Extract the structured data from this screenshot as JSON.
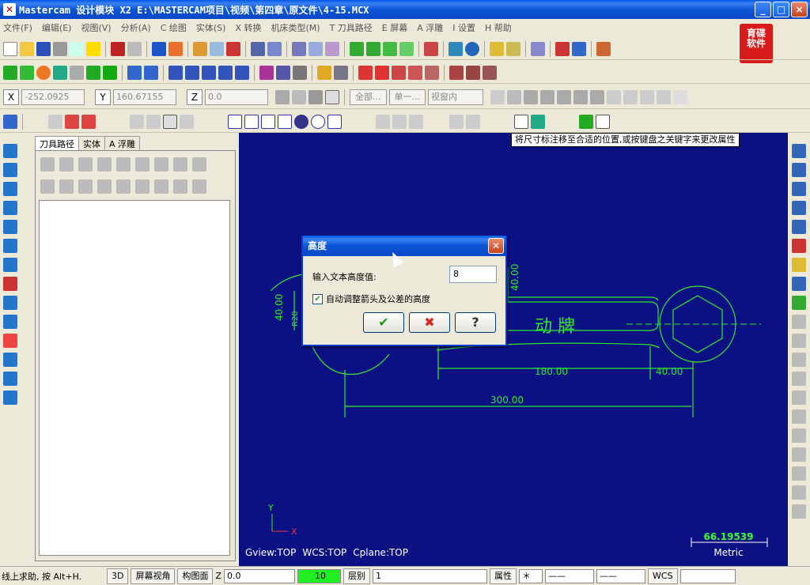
{
  "window": {
    "title": "Mastercam 设计模块  X2  E:\\MASTERCAM项目\\视频\\第四章\\原文件\\4-15.MCX",
    "controls": {
      "minimize": "_",
      "maximize": "□",
      "close": "×"
    }
  },
  "menu": [
    "文件(F)",
    "编辑(E)",
    "视图(V)",
    "分析(A)",
    "C 绘图",
    "实体(S)",
    "X 转换",
    "机床类型(M)",
    "T 刀具路径",
    "E 屏幕",
    "A 浮雕",
    "I 设置",
    "H 帮助"
  ],
  "logo": {
    "line1": "育碟",
    "line2": "软件"
  },
  "coords": {
    "x_label": "X",
    "x_value": "-252.0925",
    "y_label": "Y",
    "y_value": "160.67155",
    "z_label": "Z",
    "z_value": "0.0",
    "all_button": "全部...",
    "single_button": "单一...",
    "view_select": "视窗内"
  },
  "left_panel": {
    "tabs": [
      "刀具路径",
      "实体",
      "A 浮雕"
    ]
  },
  "canvas": {
    "hint": "将尺寸标注移至合适的位置,或按键盘之关键字来更改属性",
    "dims": [
      "40.00",
      "40.00",
      "180.00",
      "40.00",
      "300.00",
      "R20"
    ],
    "part_text": "动 牌",
    "axis_y": "Y",
    "axis_x": "X",
    "gview": "Gview:TOP",
    "wcs": "WCS:TOP",
    "cplane": "Cplane:TOP",
    "scale_value": "66.19539",
    "scale_unit": "Metric"
  },
  "dialog": {
    "title": "高度",
    "label": "输入文本高度值:",
    "value": "8",
    "checkbox_label": "自动调整箭头及公差的高度",
    "checkbox_checked": true,
    "ok": "✔",
    "cancel": "✖",
    "help": "?"
  },
  "status": {
    "hint": "线上求助, 按 Alt+H.",
    "mode_3d": "3D",
    "screen_view": "屏幕视角",
    "plane": "构图面",
    "z_label": "Z",
    "z_value": "0.0",
    "color_value": "10",
    "level_label": "层别",
    "level_value": "1",
    "attr": "属性",
    "wcs": "WCS"
  }
}
